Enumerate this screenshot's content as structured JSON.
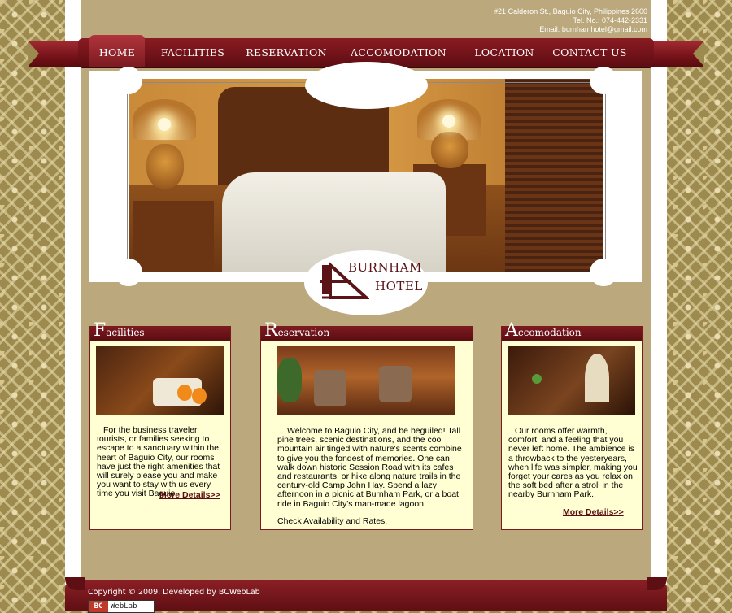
{
  "header": {
    "address": "#21 Calderon St., Baguio City, Philippines 2600",
    "tel": "Tel. No.: 074-442-2331",
    "email_label": "Email: ",
    "email": "burnhamhotel@gmail.com"
  },
  "nav": {
    "items": [
      "HOME",
      "FACILITIES",
      "RESERVATION",
      "ACCOMODATION",
      "LOCATION",
      "CONTACT US"
    ],
    "active": "HOME"
  },
  "logo": {
    "line1": "BURNHAM",
    "line2": "HOTEL"
  },
  "boxes": {
    "facilities": {
      "title_cap": "F",
      "title_rest": "acilities",
      "text": "For the business traveler, tourists, or families seeking to escape to a sanctuary within the heart of Baguio City, our rooms have just the right amenities that will surely please you and make you want to stay with us every time you visit Baguio.",
      "link": "More Details>>"
    },
    "reservation": {
      "title_cap": "R",
      "title_rest": "eservation",
      "text": "Welcome to Baguio City, and be beguiled! Tall pine trees, scenic destinations, and the cool mountain air tinged with nature's scents combine to give you the fondest of memories. One can walk down historic Session Road with its cafes and restaurants, or hike along nature trails in the century-old Camp John Hay. Spend a lazy afternoon in a picnic at Burnham Park, or a boat ride in Baguio City's man-made lagoon.",
      "cta": "Check Availability and Rates."
    },
    "accomodation": {
      "title_cap": "A",
      "title_rest": "ccomodation",
      "text": "Our rooms offer warmth, comfort, and a feeling that you never left home. The ambience is a throwback to the yesteryears, when life was simpler, making you forget your cares as you relax on the soft bed after a stroll in the nearby Burnham Park.",
      "link": "More Details>>"
    }
  },
  "footer": {
    "copyright": "Copyright © 2009. Developed by BCWebLab",
    "badge_bc": "BC",
    "badge_text": "WebLab"
  },
  "colors": {
    "brand_maroon": "#6e1016",
    "panel_tan": "#bba87c",
    "box_cream": "#ffffd3"
  }
}
